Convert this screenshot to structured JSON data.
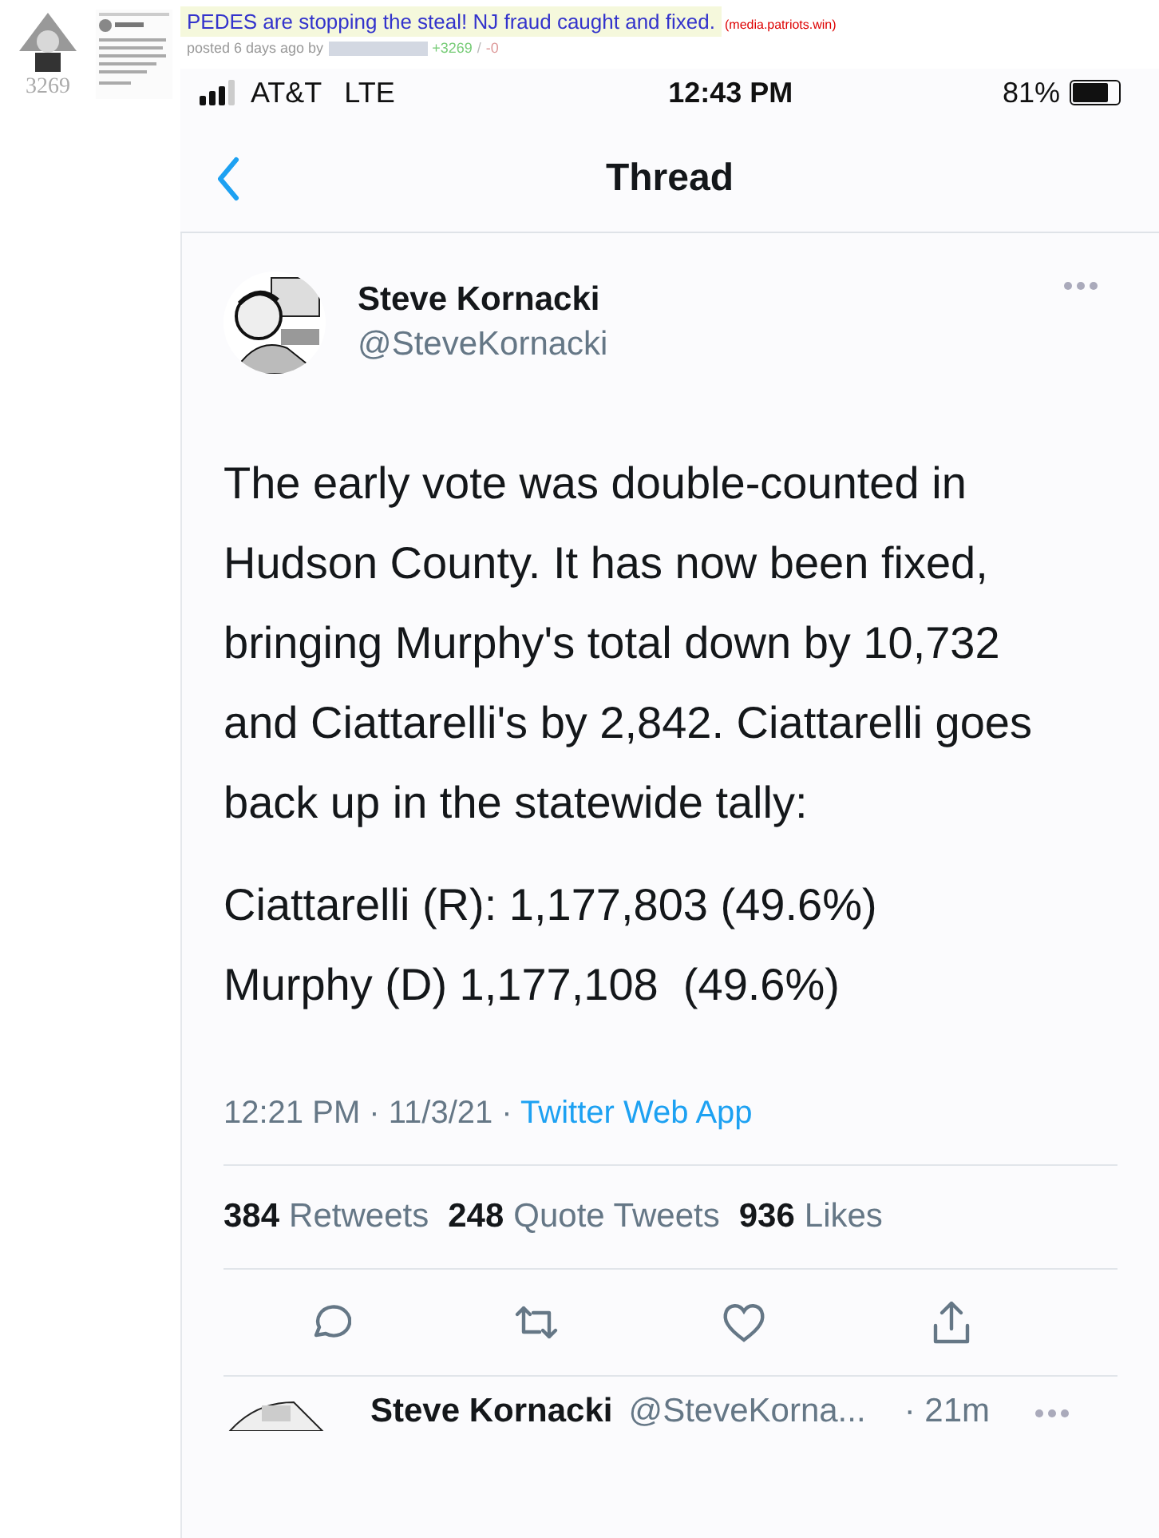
{
  "post": {
    "score": "3269",
    "title": "PEDES are stopping the steal! NJ fraud caught and fixed.",
    "domain": "(media.patriots.win)",
    "posted": "posted 6 days ago by",
    "upvotes": "+3269",
    "separator": "/",
    "downvotes": "-0"
  },
  "phone": {
    "carrier": "AT&T",
    "network": "LTE",
    "time": "12:43 PM",
    "battery": "81%",
    "nav_title": "Thread"
  },
  "tweet": {
    "name": "Steve Kornacki",
    "handle": "@SteveKornacki",
    "body": "The early vote was double-counted in Hudson County. It has now been fixed, bringing Murphy's total down by 10,732 and Ciattarelli's by 2,842. Ciattarelli goes back up in the statewide tally:",
    "results": [
      "Ciattarelli (R): 1,177,803 (49.6%)",
      "Murphy (D) 1,177,108  (49.6%)"
    ],
    "time": "12:21 PM · 11/3/21 · ",
    "source": "Twitter Web App",
    "stats": [
      {
        "count": "384",
        "label": "Retweets"
      },
      {
        "count": "248",
        "label": "Quote Tweets"
      },
      {
        "count": "936",
        "label": "Likes"
      }
    ]
  },
  "next_tweet": {
    "name": "Steve Kornacki",
    "handle": "@SteveKorna...",
    "time": "· 21m"
  }
}
